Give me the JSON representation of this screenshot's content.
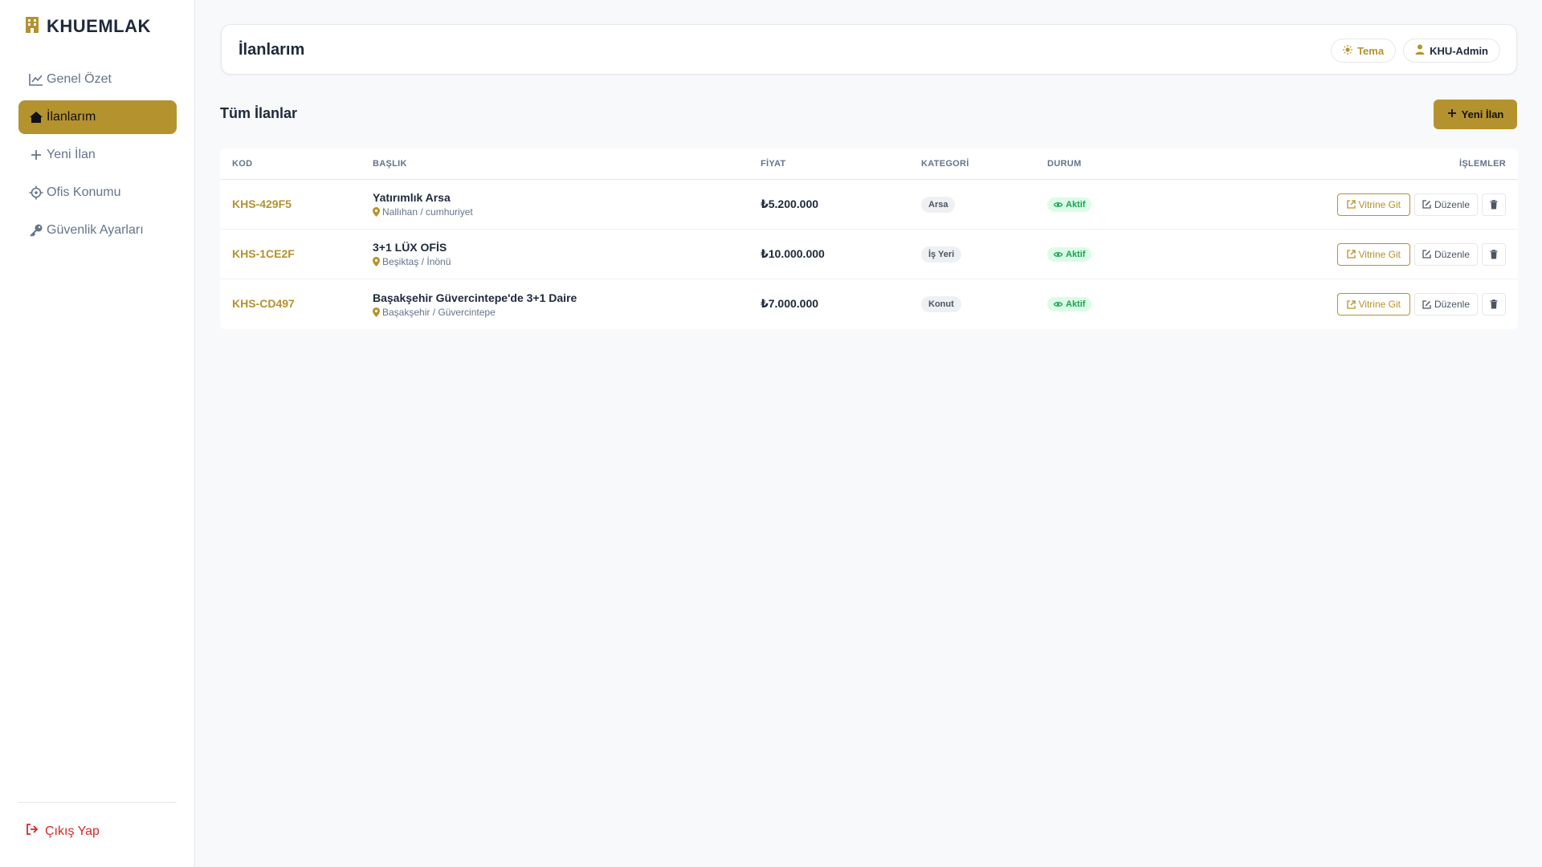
{
  "brand": {
    "name": "KHUEMLAK"
  },
  "sidebar": {
    "items": [
      {
        "label": "Genel Özet",
        "icon": "chart-line-icon"
      },
      {
        "label": "İlanlarım",
        "icon": "house-icon",
        "active": true
      },
      {
        "label": "Yeni İlan",
        "icon": "plus-icon"
      },
      {
        "label": "Ofis Konumu",
        "icon": "crosshair-icon"
      },
      {
        "label": "Güvenlik Ayarları",
        "icon": "key-icon"
      }
    ],
    "logout_label": "Çıkış Yap"
  },
  "header": {
    "title": "İlanlarım",
    "theme_label": "Tema",
    "user_label": "KHU-Admin"
  },
  "main": {
    "section_title": "Tüm İlanlar",
    "new_button_label": "Yeni İlan",
    "columns": [
      "KOD",
      "BAŞLIK",
      "FİYAT",
      "KATEGORİ",
      "DURUM",
      "İŞLEMLER"
    ],
    "rows": [
      {
        "code": "KHS-429F5",
        "title": "Yatırımlık Arsa",
        "location": "Nallıhan / cumhuriyet",
        "price": "₺5.200.000",
        "category": "Arsa",
        "status": "Aktif"
      },
      {
        "code": "KHS-1CE2F",
        "title": "3+1 LÜX OFİS",
        "location": "Beşiktaş / İnönü",
        "price": "₺10.000.000",
        "category": "İş Yeri",
        "status": "Aktif"
      },
      {
        "code": "KHS-CD497",
        "title": "Başakşehir Güvercintepe'de 3+1 Daire",
        "location": "Başakşehir / Güvercintepe",
        "price": "₺7.000.000",
        "category": "Konut",
        "status": "Aktif"
      }
    ],
    "action_labels": {
      "vitrin": "Vitrine Git",
      "edit": "Düzenle"
    }
  },
  "colors": {
    "accent": "#b4922e",
    "danger": "#dc2626",
    "success": "#16a34a"
  }
}
